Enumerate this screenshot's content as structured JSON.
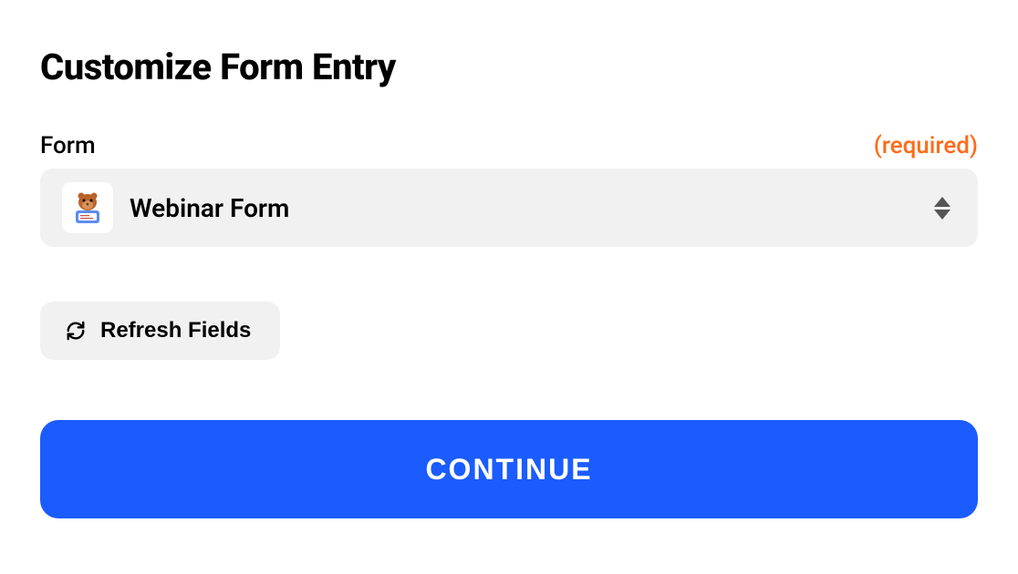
{
  "title": "Customize Form Entry",
  "form_field": {
    "label": "Form",
    "required_label": "(required)",
    "selected_value": "Webinar Form"
  },
  "refresh_button_label": "Refresh Fields",
  "continue_button_label": "Continue"
}
